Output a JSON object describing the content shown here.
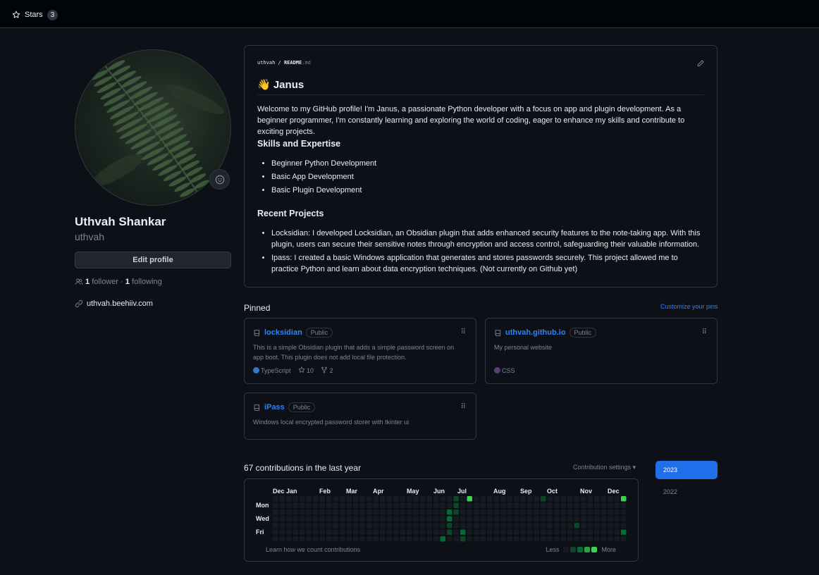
{
  "tabs": {
    "stars_label": "Stars",
    "stars_count": "3"
  },
  "profile": {
    "full_name": "Uthvah Shankar",
    "login": "uthvah",
    "edit_label": "Edit profile",
    "followers": "1",
    "followers_label": "follower",
    "following": "1",
    "following_label": "following",
    "separator": "·",
    "website": "uthvah.beehiiv.com"
  },
  "readme": {
    "owner": "uthvah",
    "file": "README",
    "ext": ".md",
    "title": "👋 Janus",
    "intro": "Welcome to my GitHub profile! I'm Janus, a passionate Python developer with a focus on app and plugin development. As a beginner programmer, I'm constantly learning and exploring the world of coding, eager to enhance my skills and contribute to exciting projects.",
    "skills_heading": "Skills and Expertise",
    "skills": [
      "Beginner Python Development",
      "Basic App Development",
      "Basic Plugin Development"
    ],
    "projects_heading": "Recent Projects",
    "projects": [
      "Locksidian: I developed Locksidian, an Obsidian plugin that adds enhanced security features to the note-taking app. With this plugin, users can secure their sensitive notes through encryption and access control, safeguarding their valuable information.",
      "Ipass: I created a basic Windows application that generates and stores passwords securely. This project allowed me to practice Python and learn about data encryption techniques. (Not currently on Github yet)"
    ]
  },
  "pinned": {
    "title": "Pinned",
    "customize": "Customize your pins",
    "repos": [
      {
        "name": "locksidian",
        "visibility": "Public",
        "description": "This is a simple Obsidian plugin that adds a simple password screen on app boot. This plugin does not add local file protection.",
        "language": "TypeScript",
        "language_color": "#3178c6",
        "stars": "10",
        "forks": "2"
      },
      {
        "name": "uthvah.github.io",
        "visibility": "Public",
        "description": "My personal website",
        "language": "CSS",
        "language_color": "#563d7c",
        "stars": "",
        "forks": ""
      },
      {
        "name": "iPass",
        "visibility": "Public",
        "description": "Windows local encrypted password storer with tkinter ui",
        "language": "",
        "language_color": "",
        "stars": "",
        "forks": ""
      }
    ]
  },
  "contributions": {
    "title": "67 contributions in the last year",
    "settings": "Contribution settings",
    "months": [
      "Dec",
      "Jan",
      "Feb",
      "Mar",
      "Apr",
      "May",
      "Jun",
      "Jul",
      "Aug",
      "Sep",
      "Oct",
      "Nov",
      "Dec"
    ],
    "days": [
      "Mon",
      "Wed",
      "Fri"
    ],
    "learn": "Learn how we count contributions",
    "less": "Less",
    "more": "More",
    "colors": [
      "#161b22",
      "#0e4429",
      "#006d32",
      "#26a641",
      "#39d353"
    ],
    "weeks": 53,
    "active_cells": [
      [
        25,
        6,
        2
      ],
      [
        26,
        2,
        2
      ],
      [
        26,
        3,
        2
      ],
      [
        26,
        4,
        1
      ],
      [
        27,
        0,
        1
      ],
      [
        27,
        1,
        1
      ],
      [
        28,
        5,
        1
      ],
      [
        28,
        6,
        1
      ],
      [
        29,
        0,
        4
      ],
      [
        40,
        0,
        1
      ],
      [
        45,
        4,
        1
      ],
      [
        52,
        0,
        4
      ],
      [
        52,
        5,
        2
      ]
    ],
    "extra_cells": [
      [
        26,
        5,
        1
      ],
      [
        27,
        2,
        1
      ],
      [
        28,
        5,
        2
      ]
    ],
    "years": [
      "2023",
      "2022"
    ]
  }
}
